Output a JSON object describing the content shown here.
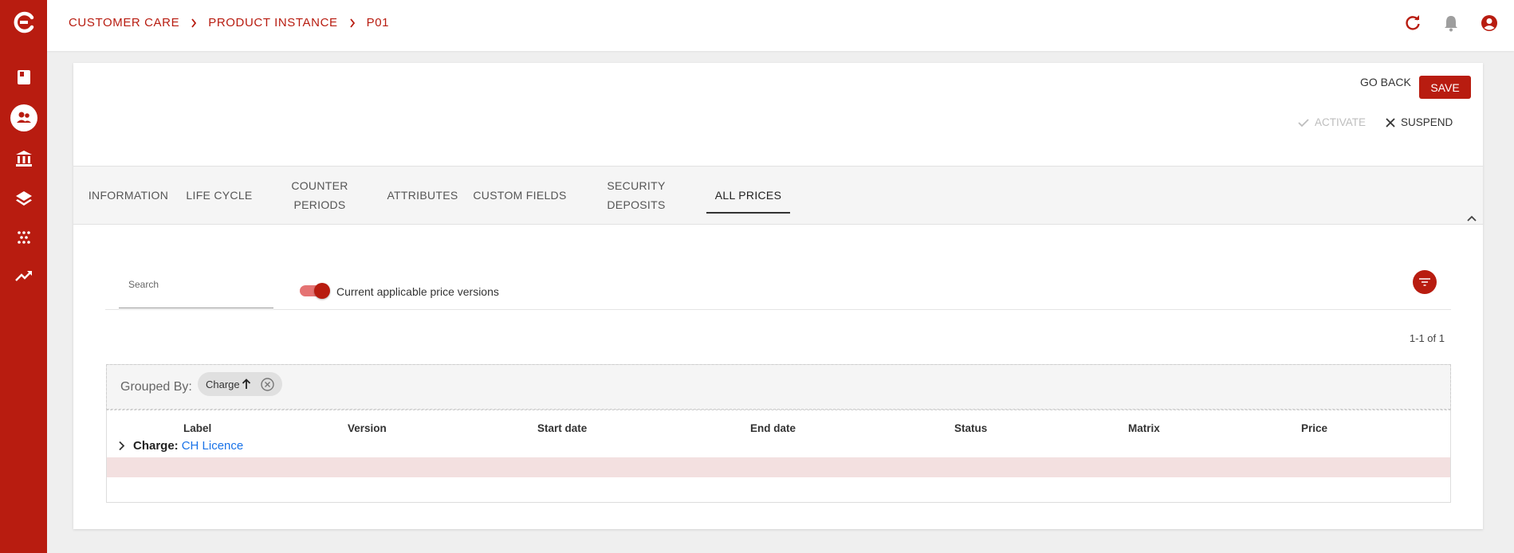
{
  "breadcrumb": [
    "CUSTOMER CARE",
    "PRODUCT INSTANCE",
    "P01"
  ],
  "sidebar": {
    "icons": [
      "logo-icon",
      "book-icon",
      "people-icon",
      "bank-icon",
      "layers-icon",
      "dots-icon",
      "trending-icon"
    ],
    "active": "people-icon"
  },
  "topbar": {
    "icons": [
      "refresh-icon",
      "bell-icon",
      "account-icon"
    ]
  },
  "actions": {
    "go_back": "GO BACK",
    "save": "SAVE",
    "activate": "ACTIVATE",
    "suspend": "SUSPEND"
  },
  "tabs": [
    {
      "label": "INFORMATION"
    },
    {
      "label": "LIFE CYCLE"
    },
    {
      "label": "COUNTER PERIODS"
    },
    {
      "label": "ATTRIBUTES"
    },
    {
      "label": "CUSTOM FIELDS"
    },
    {
      "label": "SECURITY DEPOSITS"
    },
    {
      "label": "ALL PRICES",
      "active": true
    }
  ],
  "filters": {
    "search_label": "Search",
    "toggle_label": "Current applicable price versions",
    "toggle_on": true
  },
  "pagination": "1-1 of 1",
  "table": {
    "grouped_by_label": "Grouped By:",
    "group_chip": "Charge",
    "columns": [
      "Label",
      "Version",
      "Start date",
      "End date",
      "Status",
      "Matrix",
      "Price"
    ],
    "groups": [
      {
        "key": "Charge:",
        "value": "CH Licence"
      }
    ]
  },
  "colors": {
    "primary": "#b81c10",
    "link": "#1a73e8",
    "highlight_row": "#f3e0e0"
  }
}
